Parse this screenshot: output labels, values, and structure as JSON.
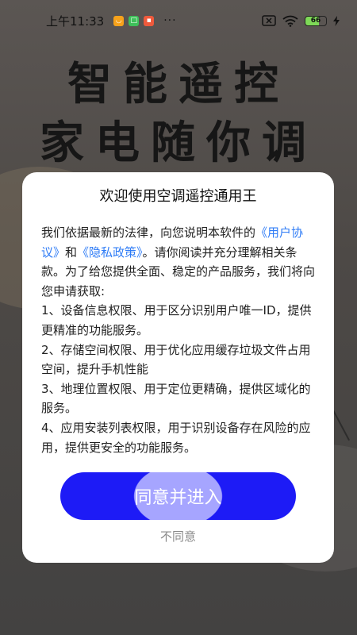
{
  "status_bar": {
    "time": "上午11:33",
    "dots": "···",
    "battery_level": "66",
    "app_badges": [
      {
        "icon": "app-badge-orange",
        "color": "#f7a21b",
        "glyph": "ᴗ"
      },
      {
        "icon": "app-badge-green",
        "color": "#3fbf5a",
        "glyph": "▫"
      },
      {
        "icon": "app-badge-red",
        "color": "#ef5a3c",
        "glyph": "▪"
      }
    ]
  },
  "hero": {
    "line1": "智能遥控",
    "line2": "家电随你调"
  },
  "dialog": {
    "title": "欢迎使用空调遥控通用王",
    "intro_before": "我们依据最新的法律，向您说明本软件的",
    "user_agreement": "《用户协议》",
    "and": "和",
    "privacy_policy": "《隐私政策》",
    "intro_after": "。请你阅读并充分理解相关条款。为了给您提供全面、稳定的产品服务，我们将向您申请获取:",
    "items": [
      "1、设备信息权限、用于区分识别用户唯一ID，提供更精准的功能服务。",
      "2、存储空间权限、用于优化应用缓存垃圾文件占用空间，提升手机性能",
      "3、地理位置权限、用于定位更精确，提供区域化的服务。",
      "4、应用安装列表权限，用于识别设备存在风险的应用，提供更安全的功能服务。"
    ],
    "agree_label": "同意并进入",
    "disagree_label": "不同意"
  },
  "colors": {
    "link": "#2f7cf6",
    "button": "#1d1bf6",
    "button_highlight": "#a6a5ff"
  }
}
